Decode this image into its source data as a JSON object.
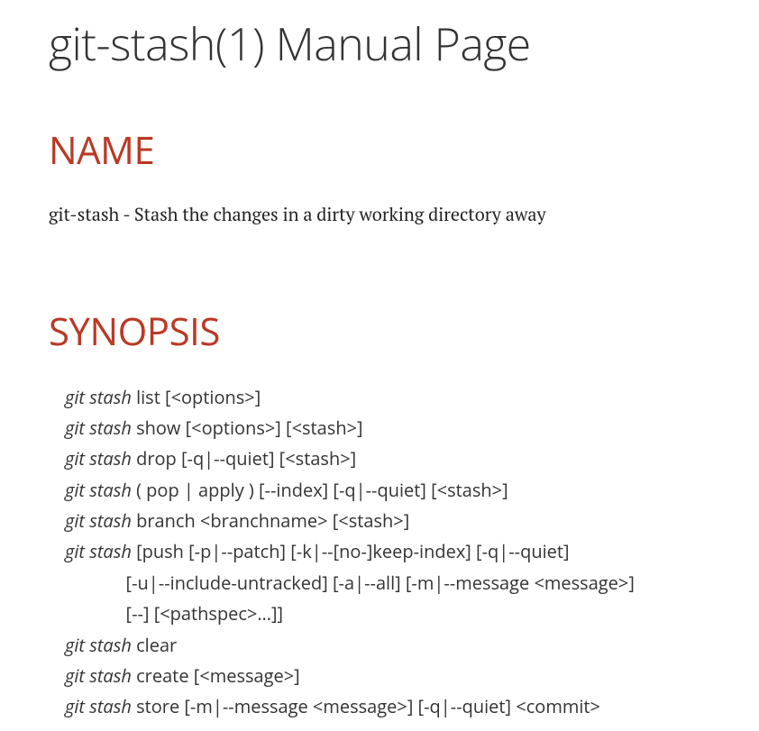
{
  "page": {
    "title": "git-stash(1) Manual Page"
  },
  "name": {
    "heading": "NAME",
    "text": "git-stash - Stash the changes in a dirty working directory away"
  },
  "synopsis": {
    "heading": "SYNOPSIS",
    "cmd": "git stash",
    "lines": {
      "l1": " list [<options>]",
      "l2": " show [<options>] [<stash>]",
      "l3": " drop [-q|--quiet] [<stash>]",
      "l4": " ( pop | apply ) [--index] [-q|--quiet] [<stash>]",
      "l5": " branch <branchname> [<stash>]",
      "l6": " [push [-p|--patch] [-k|--[no-]keep-index] [-q|--quiet]",
      "l7": "             [-u|--include-untracked] [-a|--all] [-m|--message <message>]",
      "l8": "             [--] [<pathspec>…​]]",
      "l9": " clear",
      "l10": " create [<message>]",
      "l11": " store [-m|--message <message>] [-q|--quiet] <commit>"
    }
  }
}
